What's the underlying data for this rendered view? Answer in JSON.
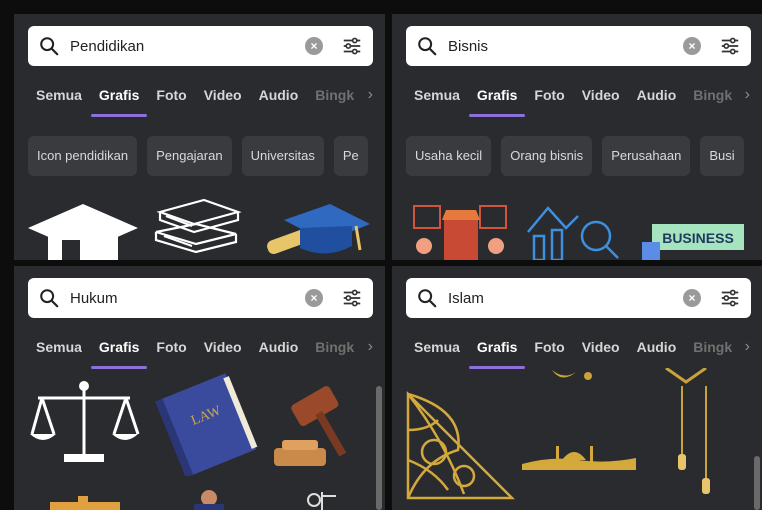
{
  "tab_chevron": "›",
  "panels": [
    {
      "query": "Pendidikan",
      "tabs": [
        "Semua",
        "Grafis",
        "Foto",
        "Video",
        "Audio",
        "Bingk"
      ],
      "chips": [
        "Icon pendidikan",
        "Pengajaran",
        "Universitas",
        "Pe"
      ]
    },
    {
      "query": "Bisnis",
      "tabs": [
        "Semua",
        "Grafis",
        "Foto",
        "Video",
        "Audio",
        "Bingk"
      ],
      "chips": [
        "Usaha kecil",
        "Orang bisnis",
        "Perusahaan",
        "Busi"
      ],
      "graphic_text": "BUSINESS"
    },
    {
      "query": "Hukum",
      "tabs": [
        "Semua",
        "Grafis",
        "Foto",
        "Video",
        "Audio",
        "Bingk"
      ],
      "graphic_text": "LAW"
    },
    {
      "query": "Islam",
      "tabs": [
        "Semua",
        "Grafis",
        "Foto",
        "Video",
        "Audio",
        "Bingk"
      ]
    }
  ],
  "colors": {
    "accent": "#8d6fdc",
    "panel_bg": "#2a2b2e",
    "chip_bg": "#3a3b3f"
  }
}
